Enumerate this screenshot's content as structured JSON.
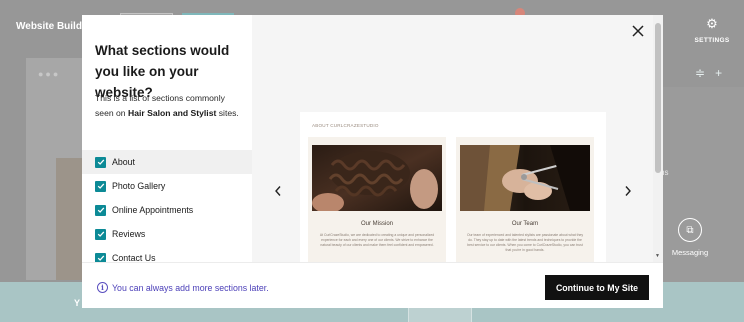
{
  "background": {
    "brand": "Website Builder",
    "settings_label": "SETTINGS",
    "right_panel_text": "ns",
    "messaging_label": "Messaging",
    "footer_text": "Y"
  },
  "modal": {
    "heading": "What sections would you like on your website?",
    "description_prefix": "This is a list of sections commonly seen on ",
    "description_bold": "Hair Salon and Stylist",
    "description_suffix": " sites.",
    "sections": [
      {
        "label": "About",
        "checked": true
      },
      {
        "label": "Photo Gallery",
        "checked": true
      },
      {
        "label": "Online Appointments",
        "checked": true
      },
      {
        "label": "Reviews",
        "checked": true
      },
      {
        "label": "Contact Us",
        "checked": true
      }
    ],
    "preview": {
      "label": "ABOUT CURLCRAZESTUDIO",
      "columns": [
        {
          "title": "Our Mission",
          "body": "At CurlCrazeStudio, we are dedicated to creating a unique and personalized experience for each and every one of our clients. We strive to enhance the natural beauty of our clients and make them feel confident and empowered."
        },
        {
          "title": "Our Team",
          "body": "Our team of experienced and talented stylists are passionate about what they do. They stay up to date with the latest trends and techniques to provide the best service to our clients. When you come to CurlCrazeStudio, you can trust that you're in good hands."
        }
      ]
    },
    "footer_info": "You can always add more sections later.",
    "continue_label": "Continue to My Site"
  },
  "colors": {
    "accent": "#0c8a96",
    "info": "#4b3fb8",
    "button": "#111111"
  }
}
